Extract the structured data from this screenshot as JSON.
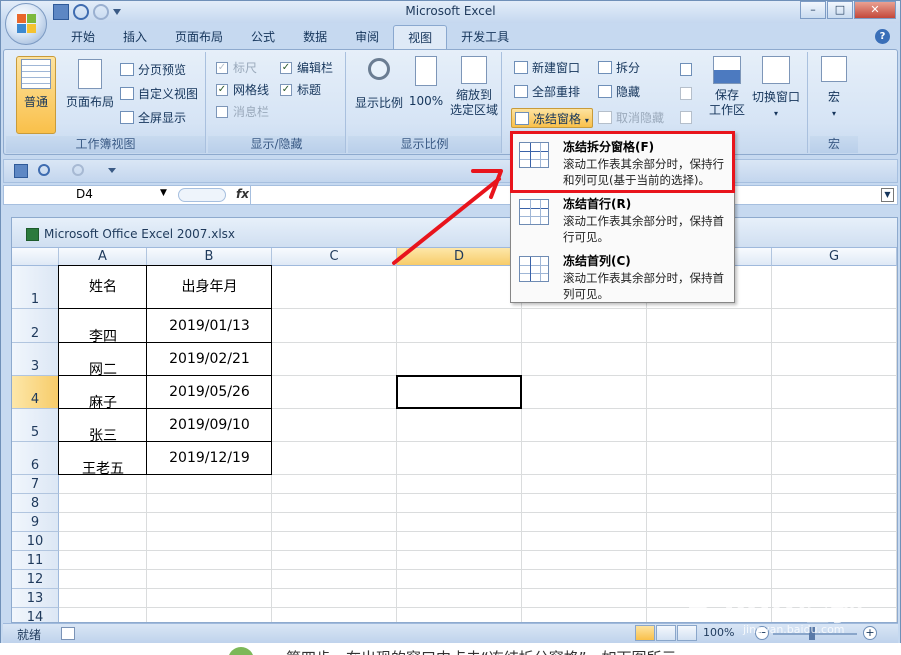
{
  "app": {
    "title": "Microsoft Excel",
    "help": "?"
  },
  "window_controls": {
    "minimize": "–",
    "maximize": "□",
    "close": "✕"
  },
  "tabs": [
    "开始",
    "插入",
    "页面布局",
    "公式",
    "数据",
    "审阅",
    "视图",
    "开发工具"
  ],
  "active_tab": "视图",
  "ribbon": {
    "workbook_views": {
      "label": "工作簿视图",
      "normal": "普通",
      "page_layout": "页面布局",
      "page_break": "分页预览",
      "custom_views": "自定义视图",
      "full_screen": "全屏显示"
    },
    "show_hide": {
      "label": "显示/隐藏",
      "ruler": "标尺",
      "formula_bar": "编辑栏",
      "gridlines": "网格线",
      "headings": "标题",
      "message_bar": "消息栏"
    },
    "zoom": {
      "label": "显示比例",
      "zoom": "显示比例",
      "hundred": "100%",
      "zoom_selection": "缩放到\n选定区域"
    },
    "window": {
      "new_window": "新建窗口",
      "arrange_all": "全部重排",
      "freeze_panes": "冻结窗格",
      "split": "拆分",
      "hide": "隐藏",
      "unhide": "取消隐藏",
      "save_workspace": "保存\n工作区",
      "switch_windows": "切换窗口"
    },
    "macros": {
      "label": "宏",
      "macros": "宏"
    }
  },
  "formula_bar": {
    "name_box": "D4",
    "fx": "fx"
  },
  "workbook": {
    "title": "Microsoft Office Excel 2007.xlsx"
  },
  "columns": [
    "A",
    "B",
    "C",
    "D",
    "E",
    "F",
    "G"
  ],
  "rows": [
    "1",
    "2",
    "3",
    "4",
    "5",
    "6",
    "7",
    "8",
    "9",
    "10",
    "11",
    "12",
    "13",
    "14"
  ],
  "table": {
    "header": [
      "姓名",
      "出身年月"
    ],
    "rows": [
      [
        "李四",
        "2019/01/13"
      ],
      [
        "网二",
        "2019/02/21"
      ],
      [
        "麻子",
        "2019/05/26"
      ],
      [
        "张三",
        "2019/09/10"
      ],
      [
        "王老五",
        "2019/12/19"
      ]
    ]
  },
  "freeze_menu": [
    {
      "title": "冻结拆分窗格(F)",
      "desc": "滚动工作表其余部分时，保持行和列可见(基于当前的选择)。"
    },
    {
      "title": "冻结首行(R)",
      "desc": "滚动工作表其余部分时，保持首行可见。"
    },
    {
      "title": "冻结首列(C)",
      "desc": "滚动工作表其余部分时，保持首列可见。"
    }
  ],
  "status": {
    "ready": "就绪",
    "zoom": "100%"
  },
  "watermark": {
    "brand": "Baidu经验",
    "url": "jingyan.baidu.com"
  },
  "caption": {
    "step": "4",
    "text": "第四步，在出现的窗口中点击“冻结拆分窗格”，如下图所示"
  },
  "colors": {
    "accent_red": "#e8141c",
    "ribbon_bg": "#dfeaf7",
    "selected_header": "#f7cc6a"
  }
}
